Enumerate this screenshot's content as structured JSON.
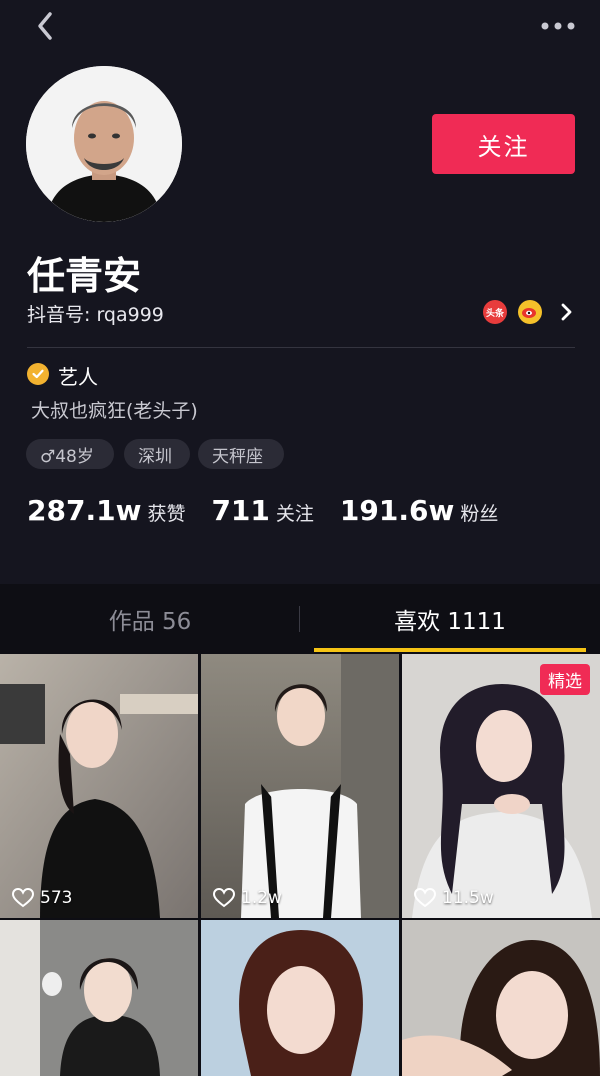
{
  "profile": {
    "name": "任青安",
    "douyin_id": "抖音号: rqa999",
    "verify": "艺人",
    "bio": "大叔也疯狂(老头子)",
    "tags": [
      "♂48岁",
      "深圳",
      "天秤座"
    ],
    "follow_label": "关注"
  },
  "social": {
    "toutiao_label": "头条"
  },
  "stats": [
    {
      "num": "287.1w",
      "label": "获赞"
    },
    {
      "num": "711",
      "label": "关注"
    },
    {
      "num": "191.6w",
      "label": "粉丝"
    }
  ],
  "tabs": [
    {
      "label": "作品 56",
      "active": false
    },
    {
      "label": "喜欢 1111",
      "active": true
    }
  ],
  "videos": [
    {
      "likes": "573",
      "badge": ""
    },
    {
      "likes": "1.2w",
      "badge": ""
    },
    {
      "likes": "11.5w",
      "badge": "精选"
    },
    {
      "likes": "",
      "badge": ""
    },
    {
      "likes": "",
      "badge": ""
    },
    {
      "likes": "",
      "badge": ""
    }
  ],
  "colors": {
    "background": "#15151f",
    "follow_button": "#f02b55",
    "tab_indicator": "#f5c415",
    "verify_badge": "#f2b230"
  }
}
